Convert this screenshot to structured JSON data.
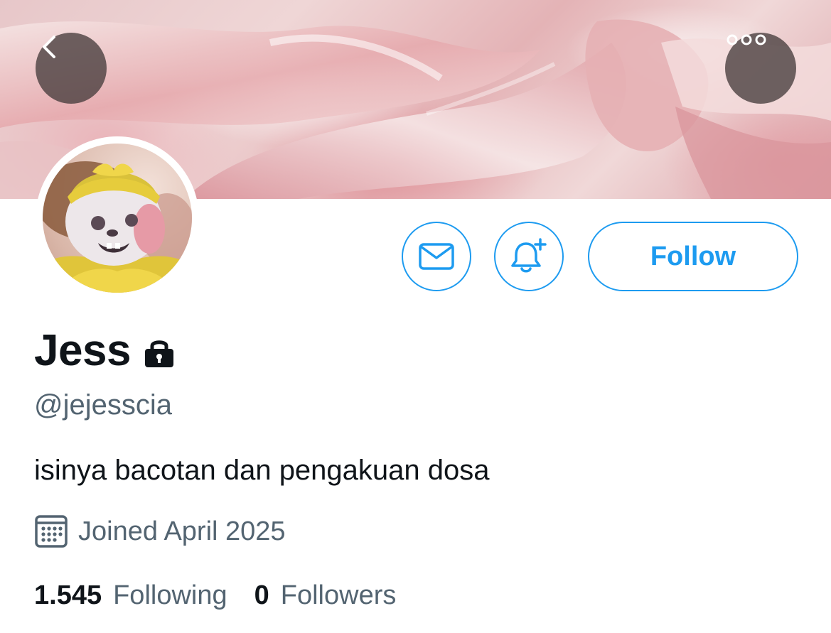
{
  "header": {
    "back_icon": "chevron-left-icon",
    "more_icon": "more-horizontal-icon"
  },
  "profile": {
    "name": "Jess",
    "protected_icon": "lock-icon",
    "handle": "@jejesscia",
    "bio": "isinya bacotan dan pengakuan dosa",
    "joined_icon": "calendar-icon",
    "joined": "Joined April 2025",
    "following_count": "1.545",
    "following_label": "Following",
    "followers_count": "0",
    "followers_label": "Followers"
  },
  "actions": {
    "message_icon": "envelope-icon",
    "notify_icon": "bell-plus-icon",
    "follow_label": "Follow"
  },
  "colors": {
    "accent": "#1d9bf0",
    "secondary_text": "#536471",
    "primary_text": "#0f1419",
    "banner_tint": "#e8b9bc"
  }
}
